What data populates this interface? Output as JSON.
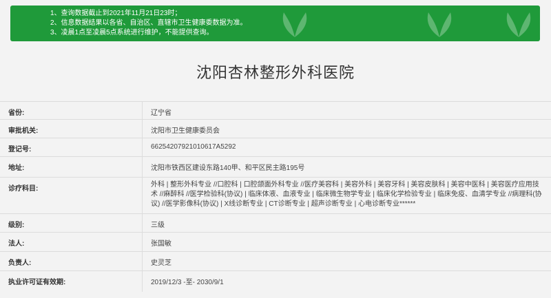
{
  "notice": {
    "items": [
      "1、查询数据截止到2021年11月21日23时；",
      "2、信息数据结果以各省、自治区、直辖市卫生健康委数据为准。",
      "3、凌晨1点至凌晨5点系统进行维护，不能提供查询。"
    ]
  },
  "hospital": {
    "title": "沈阳杏林整形外科医院",
    "fields": [
      {
        "label": "省份:",
        "value": "辽宁省"
      },
      {
        "label": "审批机关:",
        "value": "沈阳市卫生健康委员会"
      },
      {
        "label": "登记号:",
        "value": "66254207921010617A5292"
      },
      {
        "label": "地址:",
        "value": "沈阳市铁西区建设东路140甲、和平区民主路195号"
      },
      {
        "label": "诊疗科目:",
        "value": "外科 | 整形外科专业 //口腔科 | 口腔颌面外科专业 //医疗美容科 | 美容外科 | 美容牙科 | 美容皮肤科 | 美容中医科 | 美容医疗应用技术 //麻醉科 //医学检验科(协议) | 临床体液、血液专业 | 临床微生物学专业 | 临床化学检验专业 | 临床免疫、血清学专业 //病理科(协议) //医学影像科(协议) | X线诊断专业 | CT诊断专业 | 超声诊断专业 | 心电诊断专业******"
      },
      {
        "label": "级别:",
        "value": "三级"
      },
      {
        "label": "法人:",
        "value": "张国敏"
      },
      {
        "label": "负责人:",
        "value": "史灵芝"
      },
      {
        "label": "执业许可证有效期:",
        "value": "2019/12/3 -至- 2030/9/1"
      }
    ]
  }
}
